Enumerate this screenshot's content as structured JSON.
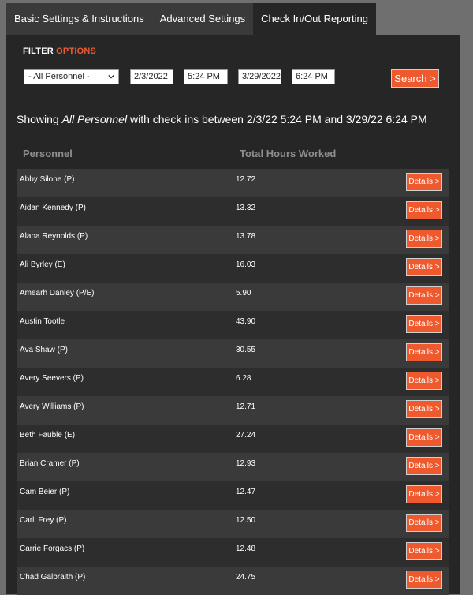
{
  "tabs": [
    {
      "label": "Basic Settings & Instructions"
    },
    {
      "label": "Advanced Settings"
    },
    {
      "label": "Check In/Out Reporting"
    }
  ],
  "filter": {
    "title": "FILTER",
    "title_accent": "OPTIONS",
    "personnel_select": "- All Personnel -",
    "start_date": "2/3/2022",
    "start_time": "5:24 PM",
    "end_date": "3/29/2022",
    "end_time": "6:24 PM",
    "search_label": "Search >"
  },
  "summary": {
    "prefix": "Showing",
    "personnel": "All Personnel",
    "middle": "with check ins between 2/3/22 5:24 PM and 3/29/22 6:24 PM"
  },
  "table": {
    "headers": {
      "personnel": "Personnel",
      "hours": "Total Hours Worked"
    },
    "details_label": "Details >",
    "rows": [
      {
        "name": "Abby Silone (P)",
        "hours": "12.72"
      },
      {
        "name": "Aidan Kennedy (P)",
        "hours": "13.32"
      },
      {
        "name": "Alana Reynolds (P)",
        "hours": "13.78"
      },
      {
        "name": "Ali Byrley (E)",
        "hours": "16.03"
      },
      {
        "name": "Amearh Danley (P/E)",
        "hours": "5.90"
      },
      {
        "name": "Austin Tootle",
        "hours": "43.90"
      },
      {
        "name": "Ava Shaw (P)",
        "hours": "30.55"
      },
      {
        "name": "Avery Seevers (P)",
        "hours": "6.28"
      },
      {
        "name": "Avery Williams (P)",
        "hours": "12.71"
      },
      {
        "name": "Beth Fauble (E)",
        "hours": "27.24"
      },
      {
        "name": "Brian Cramer (P)",
        "hours": "12.93"
      },
      {
        "name": "Cam Beier (P)",
        "hours": "12.47"
      },
      {
        "name": "Carli Frey (P)",
        "hours": "12.50"
      },
      {
        "name": "Carrie Forgacs (P)",
        "hours": "12.48"
      },
      {
        "name": "Chad Galbraith (P)",
        "hours": "24.75"
      }
    ]
  },
  "colors": {
    "accent": "#ee5a2e",
    "panel": "#262626",
    "row_odd": "#3a3a3a",
    "row_even": "#2d2d2d"
  }
}
